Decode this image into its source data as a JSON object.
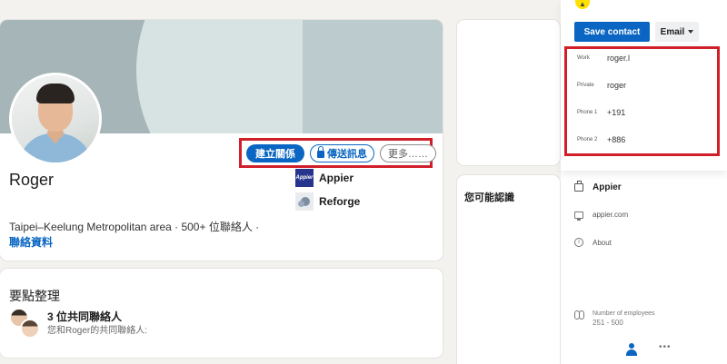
{
  "profile": {
    "name": "Roger",
    "location": "Taipei–Keelung Metropolitan area · 500+ 位聯絡人 ·",
    "contact_info_link": "聯絡資料",
    "actions": {
      "connect": "建立關係",
      "message": "傳送訊息",
      "more": "更多……"
    },
    "companies": [
      {
        "name": "Appier",
        "logo_text": "Appier"
      },
      {
        "name": "Reforge"
      }
    ]
  },
  "highlights": {
    "title": "要點整理",
    "mutual_title": "3 位共同聯絡人",
    "mutual_subtitle": "您和Roger的共同聯絡人:"
  },
  "sidebar": {
    "people_you_may_know": "您可能認識"
  },
  "contact_panel": {
    "app_icon": "bee-icon",
    "save_contact": "Save contact",
    "email_button": "Email",
    "rows": [
      {
        "label": "Work",
        "value": "roger.l"
      },
      {
        "label": "Private",
        "value": "roger"
      },
      {
        "label": "Phone 1",
        "value": "+191"
      },
      {
        "label": "Phone 2",
        "value": "+886"
      }
    ],
    "company": "Appier",
    "website": "appier.com",
    "about": "About",
    "employees_label": "Number of employees",
    "employees_value": "251 - 500"
  },
  "colors": {
    "accent": "#0a66c2",
    "highlight_border": "#d11f2a",
    "page_bg": "#f3f2ef"
  }
}
